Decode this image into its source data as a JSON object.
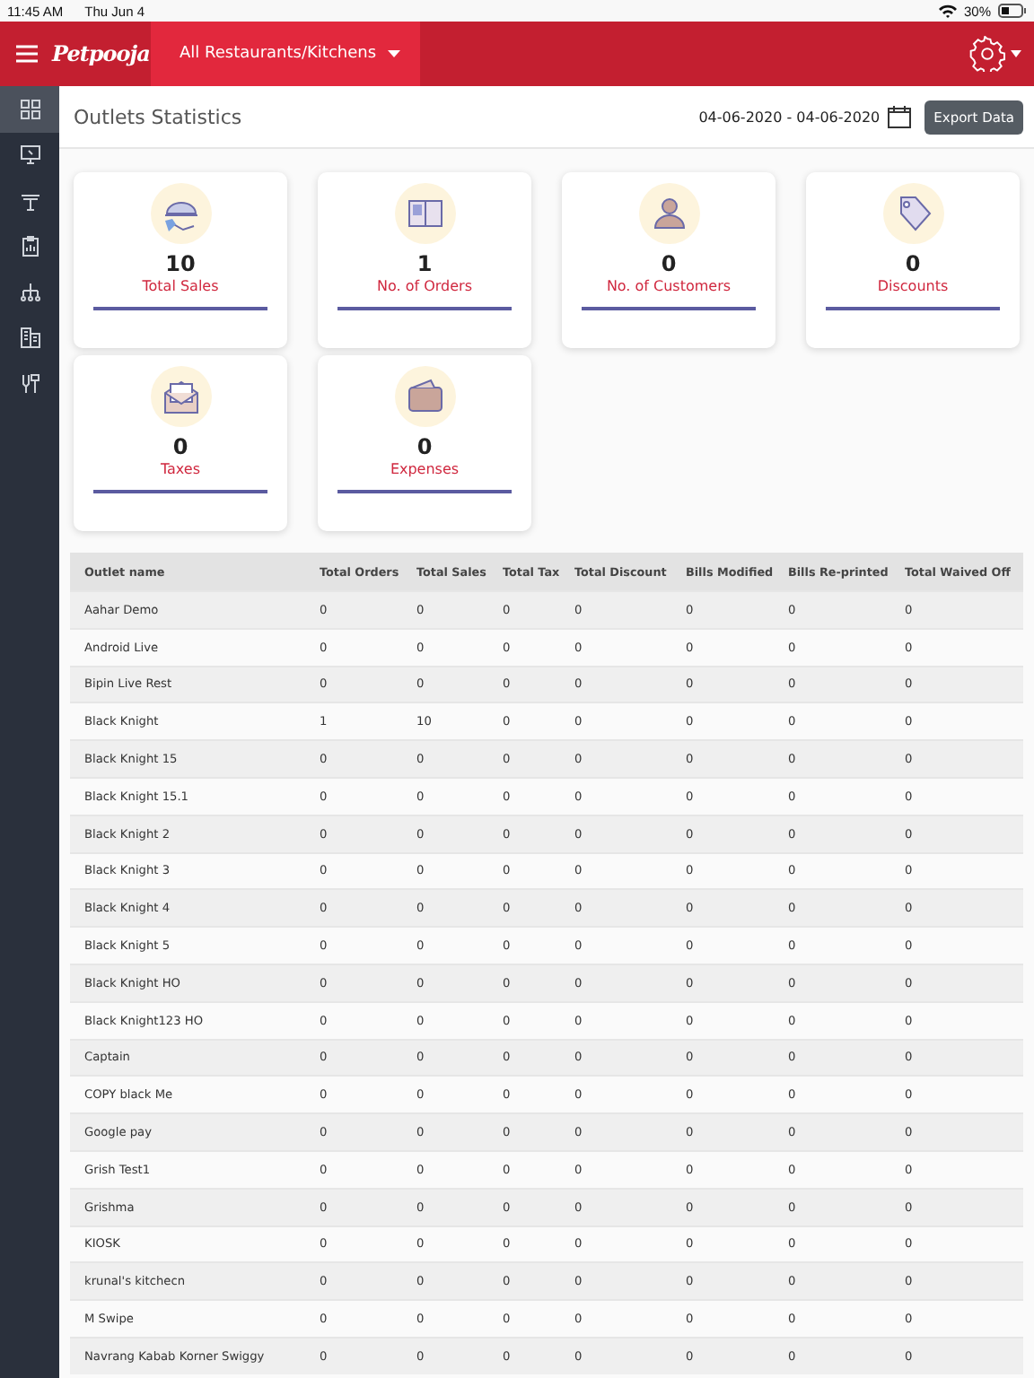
{
  "status_bar": {
    "time": "11:45 AM",
    "date": "Thu Jun 4",
    "battery": "30%"
  },
  "header": {
    "logo": "Petpooja",
    "outlet_selector": "All Restaurants/Kitchens"
  },
  "sidebar": {
    "items": [
      {
        "selected": true
      },
      {
        "selected": false
      },
      {
        "selected": false
      },
      {
        "selected": false
      },
      {
        "selected": false
      },
      {
        "selected": false
      },
      {
        "selected": false
      }
    ]
  },
  "page": {
    "title": "Outlets Statistics",
    "date_range": "04-06-2020 - 04-06-2020",
    "export_button": "Export Data"
  },
  "stats": [
    {
      "value": "10",
      "label": "Total Sales"
    },
    {
      "value": "1",
      "label": "No. of Orders"
    },
    {
      "value": "0",
      "label": "No. of Customers"
    },
    {
      "value": "0",
      "label": "Discounts"
    },
    {
      "value": "0",
      "label": "Taxes"
    },
    {
      "value": "0",
      "label": "Expenses"
    }
  ],
  "table": {
    "columns": [
      "Outlet name",
      "Total Orders",
      "Total Sales",
      "Total Tax",
      "Total Discount",
      "Bills Modified",
      "Bills Re-printed",
      "Total Waived Off"
    ],
    "rows": [
      [
        "Aahar Demo",
        "0",
        "0",
        "0",
        "0",
        "0",
        "0",
        "0"
      ],
      [
        "Android Live",
        "0",
        "0",
        "0",
        "0",
        "0",
        "0",
        "0"
      ],
      [
        "Bipin Live Rest",
        "0",
        "0",
        "0",
        "0",
        "0",
        "0",
        "0"
      ],
      [
        "Black Knight",
        "1",
        "10",
        "0",
        "0",
        "0",
        "0",
        "0"
      ],
      [
        "Black Knight 15",
        "0",
        "0",
        "0",
        "0",
        "0",
        "0",
        "0"
      ],
      [
        "Black Knight 15.1",
        "0",
        "0",
        "0",
        "0",
        "0",
        "0",
        "0"
      ],
      [
        "Black Knight 2",
        "0",
        "0",
        "0",
        "0",
        "0",
        "0",
        "0"
      ],
      [
        "Black Knight 3",
        "0",
        "0",
        "0",
        "0",
        "0",
        "0",
        "0"
      ],
      [
        "Black Knight 4",
        "0",
        "0",
        "0",
        "0",
        "0",
        "0",
        "0"
      ],
      [
        "Black Knight 5",
        "0",
        "0",
        "0",
        "0",
        "0",
        "0",
        "0"
      ],
      [
        "Black Knight HO",
        "0",
        "0",
        "0",
        "0",
        "0",
        "0",
        "0"
      ],
      [
        "Black Knight123 HO",
        "0",
        "0",
        "0",
        "0",
        "0",
        "0",
        "0"
      ],
      [
        "Captain",
        "0",
        "0",
        "0",
        "0",
        "0",
        "0",
        "0"
      ],
      [
        "COPY black Me",
        "0",
        "0",
        "0",
        "0",
        "0",
        "0",
        "0"
      ],
      [
        "Google pay",
        "0",
        "0",
        "0",
        "0",
        "0",
        "0",
        "0"
      ],
      [
        "Grish Test1",
        "0",
        "0",
        "0",
        "0",
        "0",
        "0",
        "0"
      ],
      [
        "Grishma",
        "0",
        "0",
        "0",
        "0",
        "0",
        "0",
        "0"
      ],
      [
        "KIOSK",
        "0",
        "0",
        "0",
        "0",
        "0",
        "0",
        "0"
      ],
      [
        "krunal's kitchecn",
        "0",
        "0",
        "0",
        "0",
        "0",
        "0",
        "0"
      ],
      [
        "M Swipe",
        "0",
        "0",
        "0",
        "0",
        "0",
        "0",
        "0"
      ],
      [
        "Navrang Kabab Korner Swiggy",
        "0",
        "0",
        "0",
        "0",
        "0",
        "0",
        "0"
      ]
    ]
  }
}
